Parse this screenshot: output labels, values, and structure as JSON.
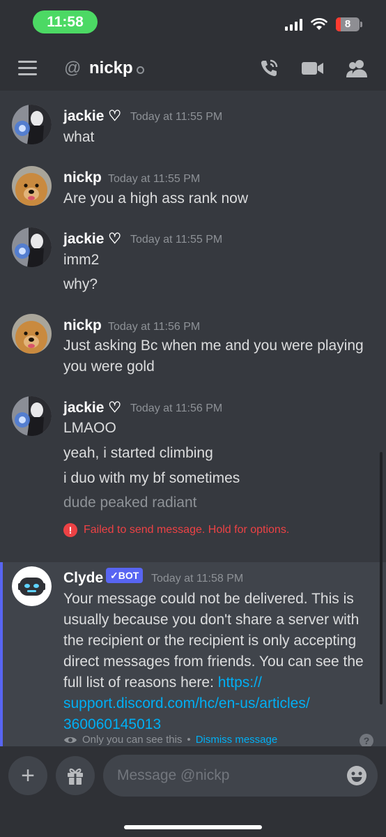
{
  "status_bar": {
    "time": "11:58",
    "battery": "8"
  },
  "header": {
    "at_symbol": "@",
    "channel_name": "nickp"
  },
  "messages": [
    {
      "author": "jackie ♡",
      "timestamp": "Today at 11:55 PM",
      "lines": [
        "what"
      ]
    },
    {
      "author": "nickp",
      "timestamp": "Today at 11:55 PM",
      "lines": [
        "Are you a high ass rank now"
      ]
    },
    {
      "author": "jackie ♡",
      "timestamp": "Today at 11:55 PM",
      "lines": [
        "imm2",
        "why?"
      ]
    },
    {
      "author": "nickp",
      "timestamp": "Today at 11:56 PM",
      "lines": [
        "Just asking Bc when me and you were playing",
        "you were gold"
      ]
    },
    {
      "author": "jackie ♡",
      "timestamp": "Today at 11:56 PM",
      "lines": [
        "LMAOO",
        "yeah, i started climbing",
        "i duo with my bf sometimes",
        "dude peaked radiant"
      ]
    }
  ],
  "failed_notice": "Failed to send message. Hold for options.",
  "clyde": {
    "author": "Clyde",
    "bot_tag": "BOT",
    "timestamp": "Today at 11:58 PM",
    "text": "Your message could not be delivered. This is usually because you don't share a server with the recipient or the recipient is only accepting direct messages from friends. You can see the full list of reasons here: ",
    "link": "https:// support.discord.com/hc/en-us/articles/ 360060145013",
    "ephemeral_note": "Only you can see this",
    "separator": "•",
    "dismiss": "Dismiss message",
    "help": "?"
  },
  "composer": {
    "placeholder": "Message @nickp",
    "plus": "+"
  },
  "colors": {
    "accent": "#5865f2",
    "error": "#ed4245",
    "link": "#00aff4",
    "status_time_bg": "#4cd964"
  },
  "icons": [
    "hamburger-icon",
    "call-icon",
    "video-icon",
    "members-icon",
    "gift-icon",
    "emoji-icon",
    "eye-icon",
    "error-icon"
  ]
}
